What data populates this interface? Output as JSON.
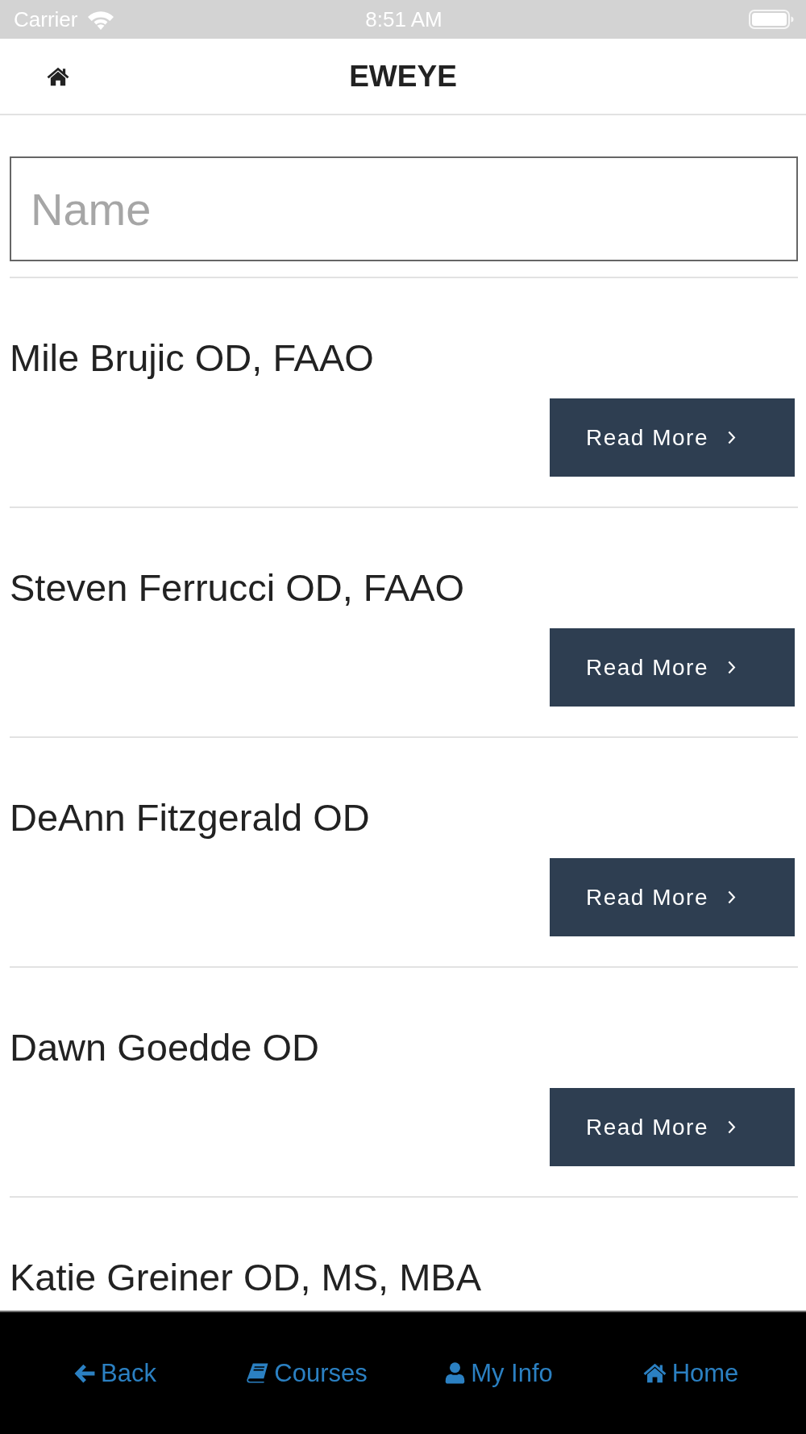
{
  "status_bar": {
    "carrier": "Carrier",
    "time": "8:51 AM"
  },
  "header": {
    "title": "EWEYE"
  },
  "search": {
    "placeholder": "Name"
  },
  "doctors": [
    {
      "name": "Mile Brujic OD, FAAO",
      "button": "Read More"
    },
    {
      "name": "Steven Ferrucci OD, FAAO",
      "button": "Read More"
    },
    {
      "name": "DeAnn Fitzgerald OD",
      "button": "Read More"
    },
    {
      "name": "Dawn Goedde OD",
      "button": "Read More"
    },
    {
      "name": "Katie Greiner OD, MS, MBA"
    }
  ],
  "tab_bar": [
    {
      "kind": "back",
      "label": "Back"
    },
    {
      "kind": "courses",
      "label": "Courses"
    },
    {
      "kind": "my-info",
      "label": "My Info"
    },
    {
      "kind": "home",
      "label": "Home"
    }
  ]
}
